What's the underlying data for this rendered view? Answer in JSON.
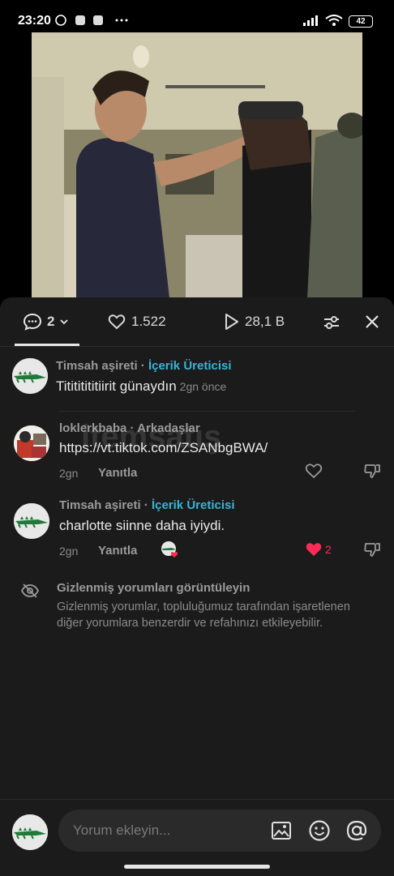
{
  "status": {
    "time": "23:20",
    "battery": "42"
  },
  "tabs": {
    "comments_count": "2",
    "likes": "1.522",
    "views": "28,1 B"
  },
  "comments": [
    {
      "author": "Timsah aşireti",
      "sep": " · ",
      "role": "İçerik Üreticisi",
      "text": "Titititititiirit günaydın",
      "time": "2gn önce"
    },
    {
      "author": "loklerkbaba",
      "sep": " · ",
      "role": "Arkadaşlar",
      "text": "https://vt.tiktok.com/ZSANbgBWA/",
      "time": "2gn",
      "reply": "Yanıtla"
    },
    {
      "author": "Timsah aşireti",
      "sep": " · ",
      "role": "İçerik Üreticisi",
      "text": "charlotte siinne daha iyiydi.",
      "time": "2gn",
      "reply": "Yanıtla",
      "likes": "2"
    }
  ],
  "hidden": {
    "title": "Gizlenmiş yorumları görüntüleyin",
    "desc": "Gizlenmiş yorumlar, topluluğumuz tarafından işaretlenen diğer yorumlara benzerdir ve refahınızı etkileyebilir."
  },
  "input": {
    "placeholder": "Yorum ekleyin..."
  },
  "watermark": "itemsatış",
  "colors": {
    "accent": "#35b6d6",
    "liked": "#fe2c55",
    "panel": "#1b1b1b"
  }
}
